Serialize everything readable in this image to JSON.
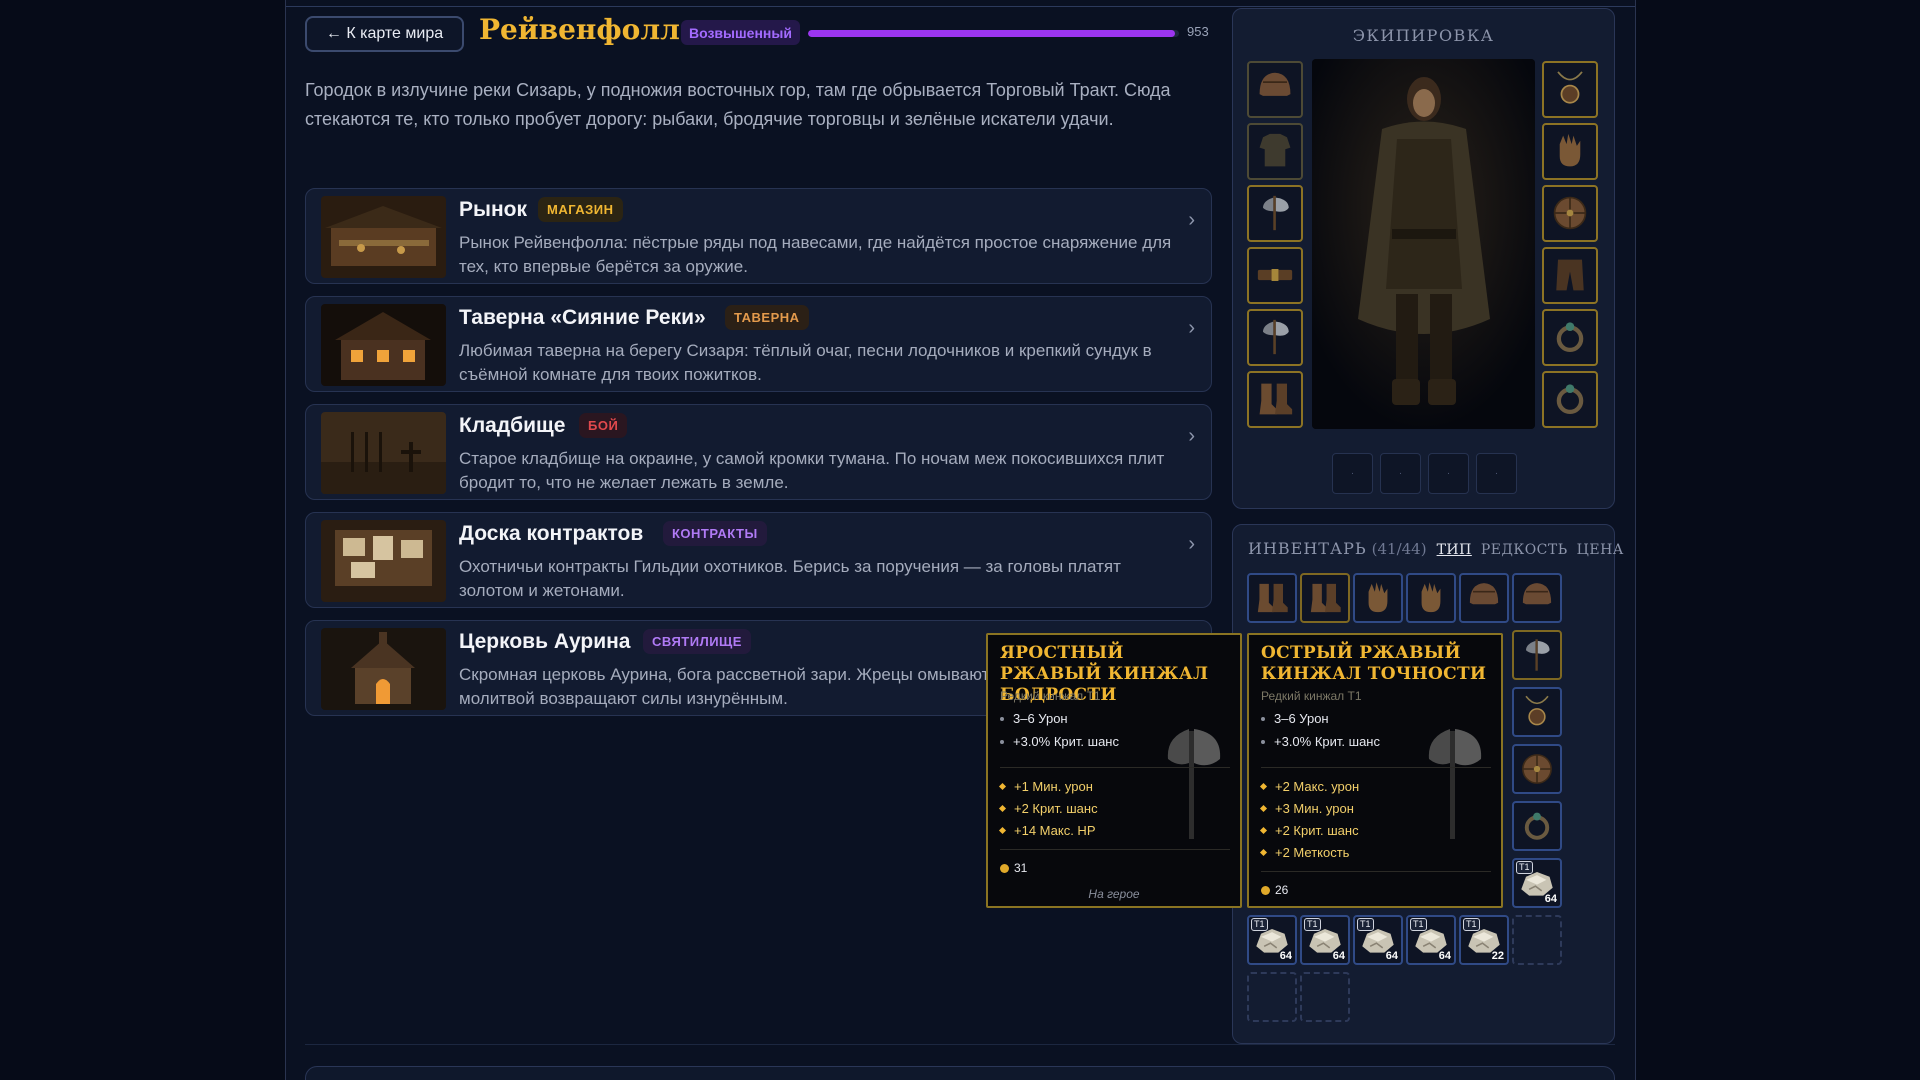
{
  "header": {
    "back_label": "← К карте мира",
    "city_name": "Рейвенфолл",
    "rank": "Возвышенный",
    "progress_value": "953",
    "progress_fraction": 0.99
  },
  "description": "Городок в излучине реки Сизарь, у подножия восточных гор, там где обрывается Торговый Тракт. Сюда стекаются те, кто только пробует дорогу: рыбаки, бродячие торговцы и зелёные искатели удачи.",
  "locations": [
    {
      "name": "Рынок",
      "tag": "МАГАЗИН",
      "tag_color": "#f0b632",
      "tag_bg": "#2b2413",
      "desc": "Рынок Рейвенфолла: пёстрые ряды под навесами, где найдётся простое снаряжение для тех, кто впервые берётся за оружие."
    },
    {
      "name": "Таверна «Сияние Реки»",
      "tag": "ТАВЕРНА",
      "tag_color": "#e39a4c",
      "tag_bg": "#2b2016",
      "desc": "Любимая таверна на берегу Сизаря: тёплый очаг, песни лодочников и крепкий сундук в съёмной комнате для твоих пожитков."
    },
    {
      "name": "Кладбище",
      "tag": "БОЙ",
      "tag_color": "#e0494d",
      "tag_bg": "#2a1620",
      "desc": "Старое кладбище на окраине, у самой кромки тумана. По ночам меж покосившихся плит бродит то, что не желает лежать в земле."
    },
    {
      "name": "Доска контрактов",
      "tag": "КОНТРАКТЫ",
      "tag_color": "#b07af5",
      "tag_bg": "#221a3c",
      "desc": "Охотничьи контракты Гильдии охотников. Берись за поручения — за головы платят золотом и жетонами."
    },
    {
      "name": "Церковь Аурина",
      "tag": "СВЯТИЛИЩЕ",
      "tag_color": "#b07af5",
      "tag_bg": "#221a3c",
      "desc": "Скромная церковь Аурина, бога рассветной зари. Жрецы омывают путников светом и молитвой возвращают силы изнурённым."
    }
  ],
  "equipment": {
    "title": "ЭКИПИРОВКА",
    "left_slots": [
      "helmet-icon",
      "shirt-icon",
      "axe-icon",
      "belt-icon",
      "axe-icon",
      "boots-icon"
    ],
    "right_slots": [
      "amulet-icon",
      "gloves-icon",
      "shield-icon",
      "pants-icon",
      "ring-icon",
      "ring-icon"
    ],
    "quick_slots": [
      "·",
      "·",
      "·",
      "·"
    ]
  },
  "inventory": {
    "title": "ИНВЕНТАРЬ",
    "count": "(41/44)",
    "sort_options": [
      "ТИП",
      "РЕДКОСТЬ",
      "ЦЕНА"
    ],
    "rows": [
      [
        {
          "icon": "boots-icon",
          "rarity": "blue"
        },
        {
          "icon": "boots-icon",
          "rarity": "gold"
        },
        {
          "icon": "gloves-icon",
          "rarity": "blue"
        },
        {
          "icon": "gloves-icon",
          "rarity": "blue"
        },
        {
          "icon": "helmet-icon",
          "rarity": "blue"
        },
        {
          "icon": "helmet-icon",
          "rarity": "blue"
        }
      ],
      [
        {
          "icon": "axe-icon",
          "rarity": "gold"
        }
      ],
      [
        {
          "icon": "amulet-icon",
          "rarity": "blue"
        }
      ],
      [
        {
          "icon": "shield-icon",
          "rarity": "blue"
        }
      ],
      [
        {
          "icon": "ring-icon",
          "rarity": "blue"
        }
      ],
      [
        {
          "icon": "ore-icon",
          "rarity": "blue",
          "tier": "T1",
          "qty": "64"
        }
      ],
      [
        {
          "icon": "ore-icon",
          "rarity": "blue",
          "tier": "T1",
          "qty": "64"
        },
        {
          "icon": "ore-icon",
          "rarity": "blue",
          "tier": "T1",
          "qty": "64"
        },
        {
          "icon": "ore-icon",
          "rarity": "blue",
          "tier": "T1",
          "qty": "64"
        },
        {
          "icon": "ore-icon",
          "rarity": "blue",
          "tier": "T1",
          "qty": "64"
        },
        {
          "icon": "ore-icon",
          "rarity": "blue",
          "tier": "T1",
          "qty": "22"
        },
        {
          "icon": "",
          "rarity": "empty"
        }
      ],
      [
        {
          "icon": "",
          "rarity": "empty"
        },
        {
          "icon": "",
          "rarity": "empty"
        }
      ]
    ]
  },
  "tooltips": [
    {
      "title": "ЯРОСТНЫЙ РЖАВЫЙ КИНЖАЛ БОДРОСТИ",
      "subtitle": "Редкий кинжал T1",
      "base": [
        "3–6 Урон",
        "+3.0% Крит. шанс"
      ],
      "affixes": [
        "+1 Мин. урон",
        "+2 Крит. шанс",
        "+14 Макс. HP"
      ],
      "price": "31",
      "footer": "На герое"
    },
    {
      "title": "ОСТРЫЙ РЖАВЫЙ КИНЖАЛ ТОЧНОСТИ",
      "subtitle": "Редкий кинжал T1",
      "base": [
        "3–6 Урон",
        "+3.0% Крит. шанс"
      ],
      "affixes": [
        "+2 Макс. урон",
        "+3 Мин. урон",
        "+2 Крит. шанс",
        "+2 Меткость"
      ],
      "price": "26",
      "footer": ""
    }
  ],
  "colors": {
    "accent_gold": "#f0b632",
    "accent_purple": "#9c35f0",
    "background": "#0a1122"
  }
}
